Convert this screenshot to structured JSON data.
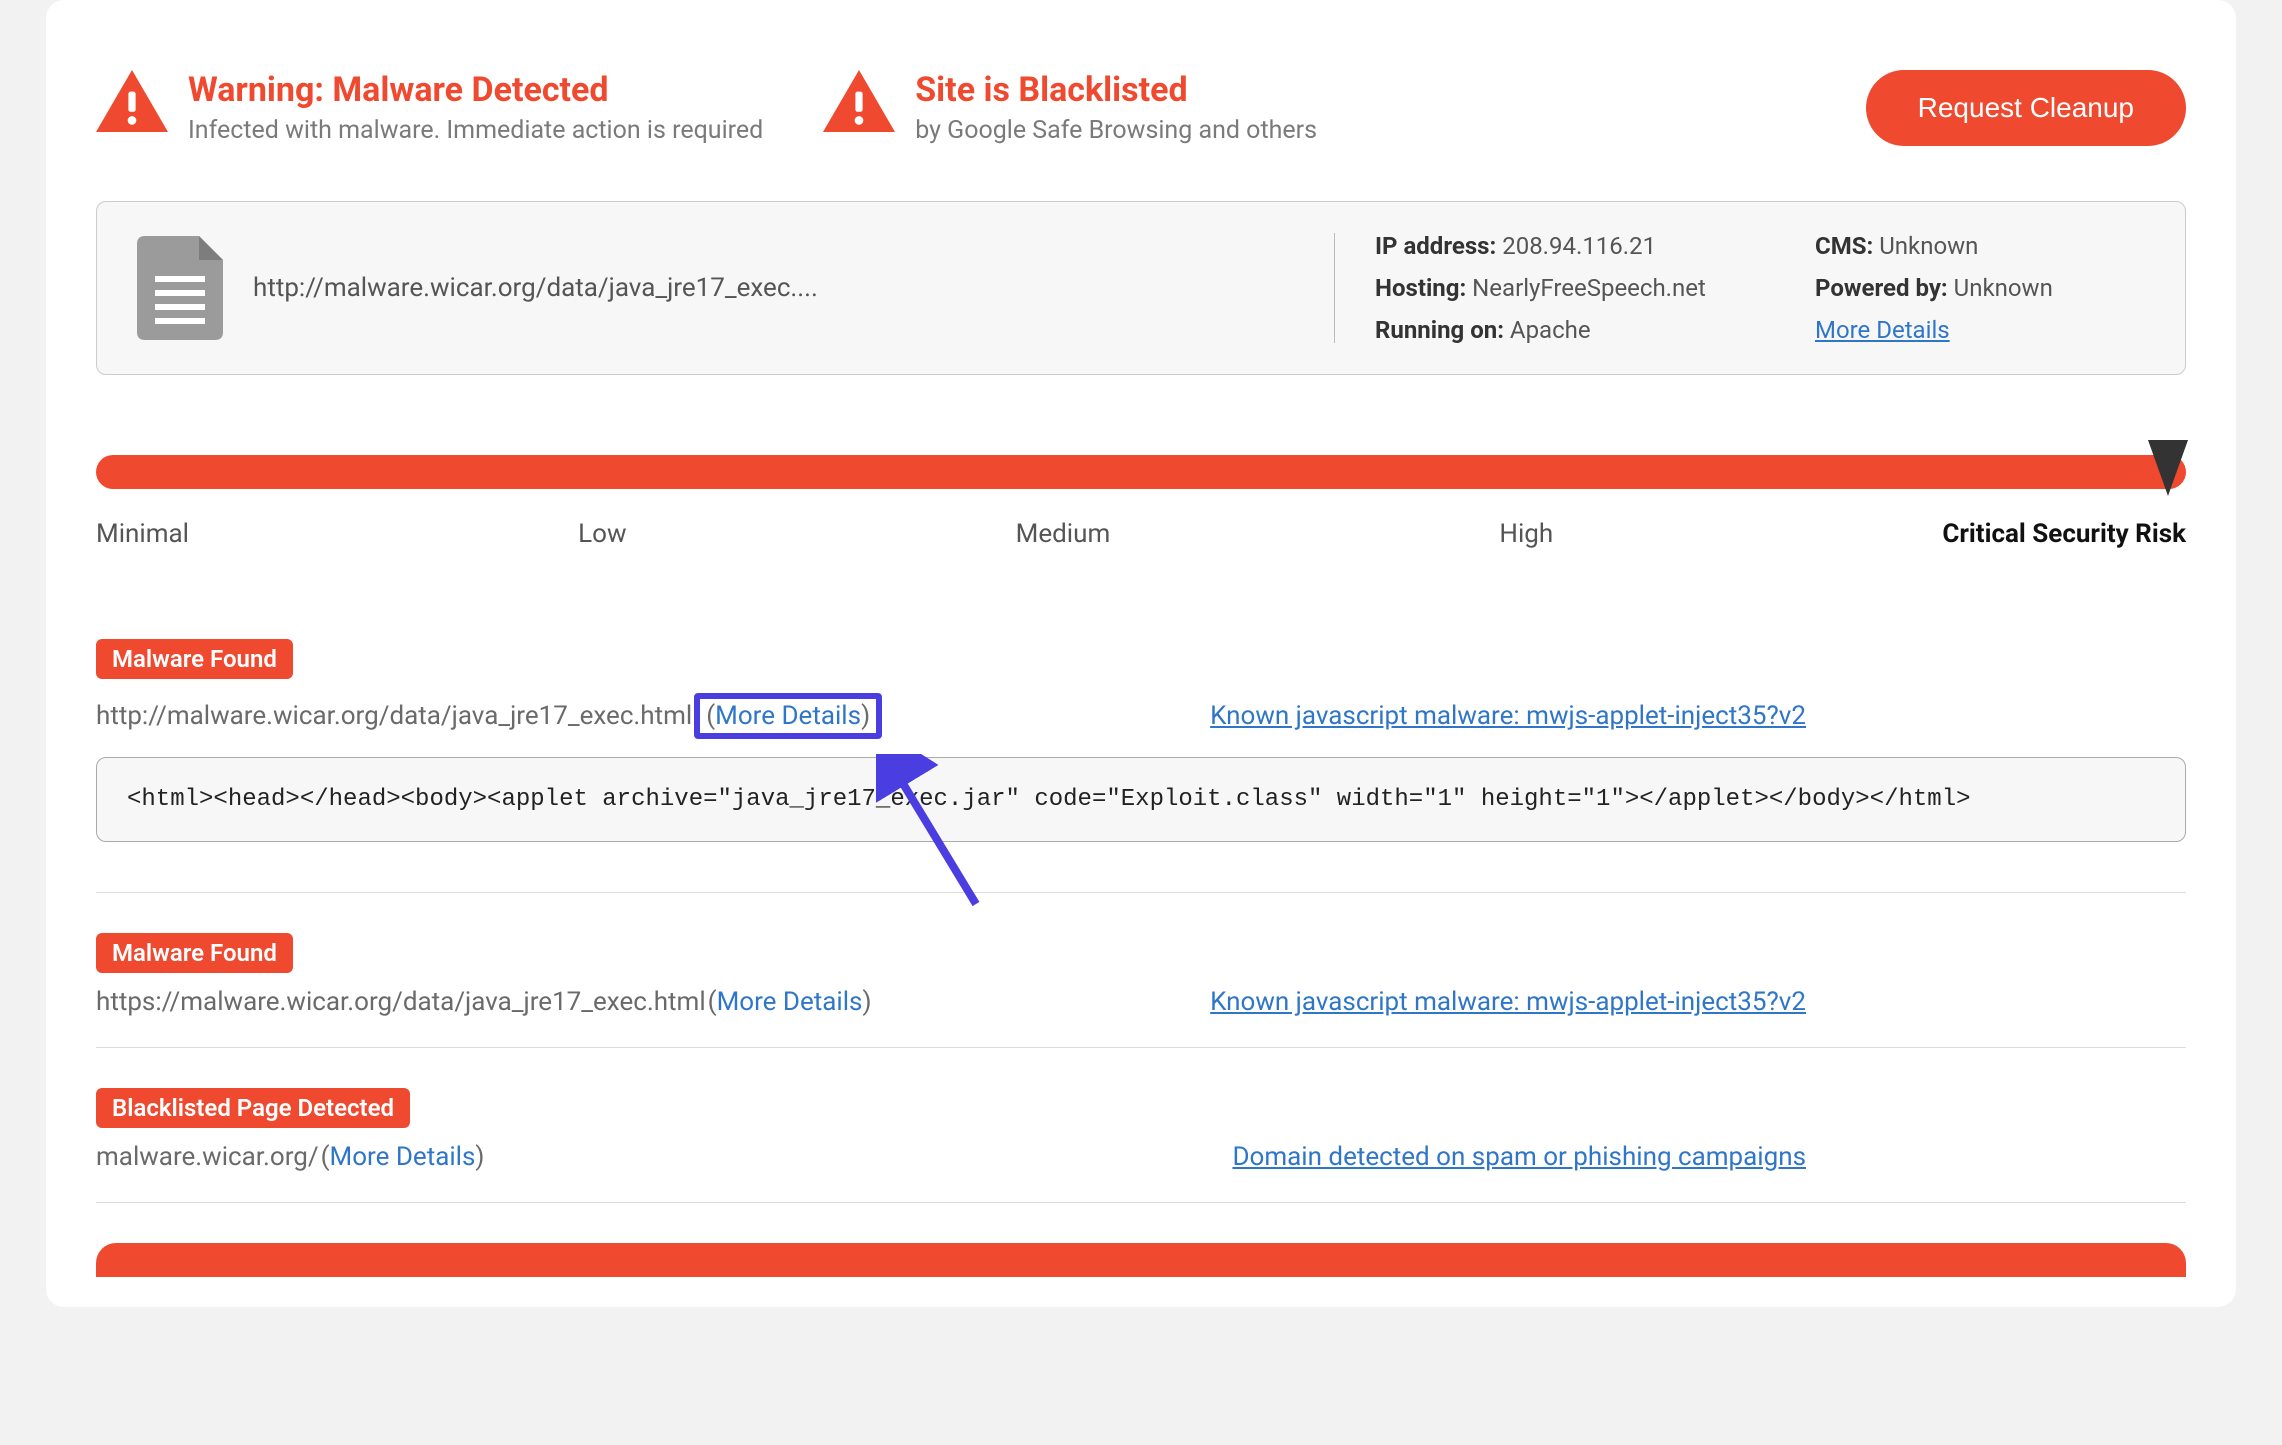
{
  "alerts": {
    "malware": {
      "title": "Warning: Malware Detected",
      "subtitle": "Infected with malware. Immediate action is required"
    },
    "blacklist": {
      "title": "Site is Blacklisted",
      "subtitle": "by Google Safe Browsing and others"
    }
  },
  "cleanup_button": "Request Cleanup",
  "site": {
    "url": "http://malware.wicar.org/data/java_jre17_exec....",
    "ip_label": "IP address:",
    "ip": "208.94.116.21",
    "hosting_label": "Hosting:",
    "hosting": "NearlyFreeSpeech.net",
    "running_label": "Running on:",
    "running": "Apache",
    "cms_label": "CMS:",
    "cms": "Unknown",
    "powered_label": "Powered by:",
    "powered": "Unknown",
    "more": "More Details"
  },
  "risk": {
    "levels": [
      "Minimal",
      "Low",
      "Medium",
      "High",
      "Critical Security Risk"
    ]
  },
  "findings": [
    {
      "badge": "Malware Found",
      "url": "http://malware.wicar.org/data/java_jre17_exec.html",
      "details_open": "(",
      "details_text": "More Details",
      "details_close": ")",
      "classification": "Known javascript malware: mwjs-applet-inject35?v2",
      "code": "<html><head></head><body><applet archive=\"java_jre17_exec.jar\" code=\"Exploit.class\" width=\"1\" height=\"1\"></applet></body></html>",
      "highlighted": true
    },
    {
      "badge": "Malware Found",
      "url": "https://malware.wicar.org/data/java_jre17_exec.html ",
      "details_open": "(",
      "details_text": "More Details",
      "details_close": ")",
      "classification": "Known javascript malware: mwjs-applet-inject35?v2",
      "highlighted": false
    },
    {
      "badge": "Blacklisted Page Detected",
      "url": "malware.wicar.org/ ",
      "details_open": "(",
      "details_text": "More Details",
      "details_close": ")",
      "classification": "Domain detected on spam or phishing campaigns",
      "highlighted": false
    }
  ]
}
